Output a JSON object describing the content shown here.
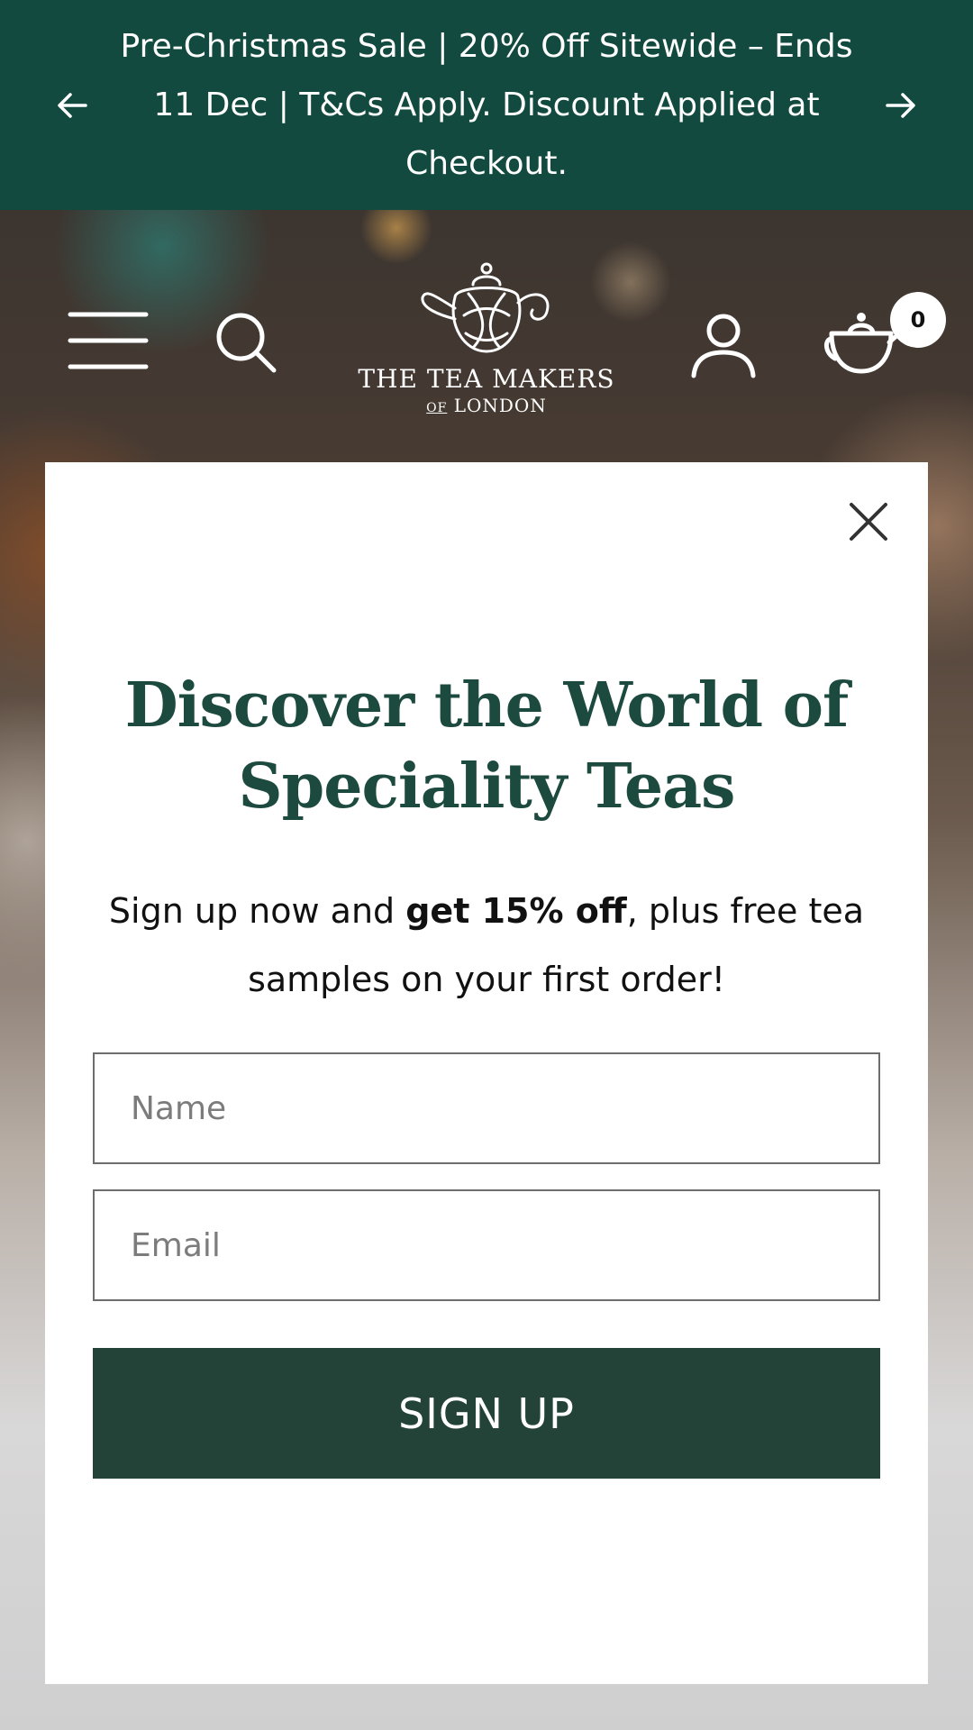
{
  "announcement": {
    "text": "Pre-Christmas Sale | 20% Off Sitewide – Ends 11 Dec | T&Cs Apply. Discount Applied at Checkout.",
    "prev_icon": "arrow-left-icon",
    "next_icon": "arrow-right-icon",
    "background": "#124a3f"
  },
  "header": {
    "logo": {
      "name": "THE TEA MAKERS",
      "sub_of": "OF",
      "sub_place": "LONDON"
    },
    "icons": {
      "menu": "hamburger-menu-icon",
      "search": "search-icon",
      "account": "user-icon",
      "cart": "teapot-cart-icon"
    },
    "cart_count": "0"
  },
  "modal": {
    "title": "Discover the World of Speciality Teas",
    "desc_before": "Sign up now and ",
    "desc_bold": "get 15% off",
    "desc_after": ", plus free tea samples on your first order!",
    "name_placeholder": "Name",
    "email_placeholder": "Email",
    "signup_label": "SIGN UP",
    "close_icon": "close-icon",
    "accent": "#1d4a3f",
    "button_color": "#234339"
  }
}
